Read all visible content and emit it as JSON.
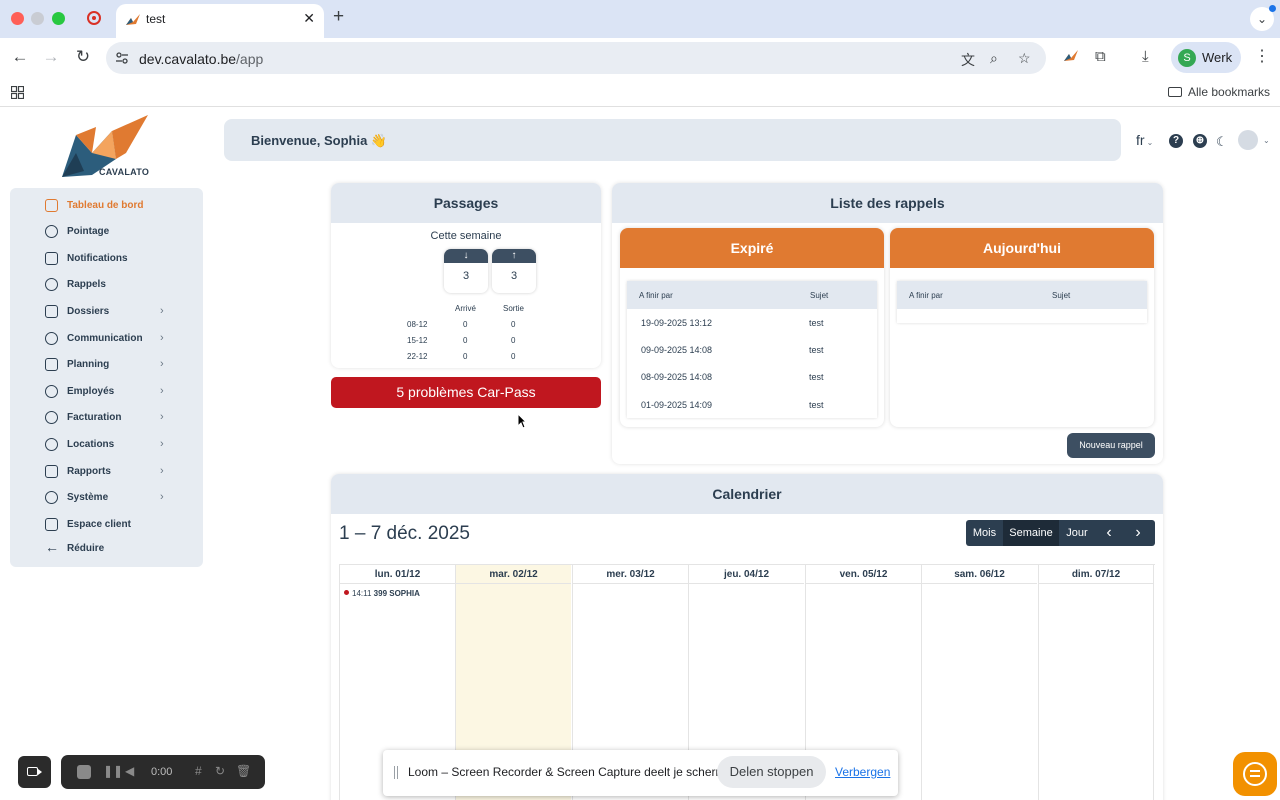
{
  "browser": {
    "tab_title": "test",
    "tab_close": "✕",
    "new_tab": "+",
    "url_host": "dev.cavalato.be",
    "url_path": "/app",
    "profile_initial": "S",
    "profile_name": "Werk",
    "all_bookmarks": "Alle bookmarks"
  },
  "app": {
    "logo_text": "CAVALATO",
    "welcome": "Bienvenue, Sophia 👋",
    "language": "fr"
  },
  "sidebar": {
    "items": [
      {
        "label": "Tableau de bord",
        "active": true,
        "chevron": false
      },
      {
        "label": "Pointage",
        "chevron": false
      },
      {
        "label": "Notifications",
        "chevron": false
      },
      {
        "label": "Rappels",
        "chevron": false
      },
      {
        "label": "Dossiers",
        "chevron": true
      },
      {
        "label": "Communication",
        "chevron": true
      },
      {
        "label": "Planning",
        "chevron": true
      },
      {
        "label": "Employés",
        "chevron": true
      },
      {
        "label": "Facturation",
        "chevron": true
      },
      {
        "label": "Locations",
        "chevron": true
      },
      {
        "label": "Rapports",
        "chevron": true
      },
      {
        "label": "Système",
        "chevron": true
      },
      {
        "label": "Espace client",
        "chevron": false
      },
      {
        "label": "Réduire",
        "chevron": false
      }
    ]
  },
  "passages": {
    "title": "Passages",
    "week_label": "Cette semaine",
    "in_count": "3",
    "out_count": "3",
    "col_in": "Arrivé",
    "col_out": "Sortie",
    "rows": [
      {
        "date": "08-12",
        "in": "0",
        "out": "0"
      },
      {
        "date": "15-12",
        "in": "0",
        "out": "0"
      },
      {
        "date": "22-12",
        "in": "0",
        "out": "0"
      }
    ],
    "carpass_button": "5 problèmes Car-Pass"
  },
  "rappels": {
    "title": "Liste des rappels",
    "expired_title": "Expiré",
    "today_title": "Aujourd'hui",
    "col_due": "A finir par",
    "col_subject": "Sujet",
    "expired_rows": [
      {
        "due": "19-09-2025 13:12",
        "subject": "test"
      },
      {
        "due": "09-09-2025 14:08",
        "subject": "test"
      },
      {
        "due": "08-09-2025 14:08",
        "subject": "test"
      },
      {
        "due": "01-09-2025 14:09",
        "subject": "test"
      }
    ],
    "new_button": "Nouveau rappel"
  },
  "calendar": {
    "title": "Calendrier",
    "range": "1 – 7 déc. 2025",
    "views": [
      "Mois",
      "Semaine",
      "Jour"
    ],
    "selected_view": "Semaine",
    "prev": "‹",
    "next": "›",
    "days": [
      "lun. 01/12",
      "mar. 02/12",
      "mer. 03/12",
      "jeu. 04/12",
      "ven. 05/12",
      "sam. 06/12",
      "dim. 07/12"
    ],
    "event_time": "14:11",
    "event_title": "399 SOPHIA"
  },
  "loom": {
    "time": "0:00",
    "share_text": "Loom – Screen Recorder & Screen Capture deelt je scherm.",
    "stop_button": "Delen stoppen",
    "hide_link": "Verbergen"
  }
}
